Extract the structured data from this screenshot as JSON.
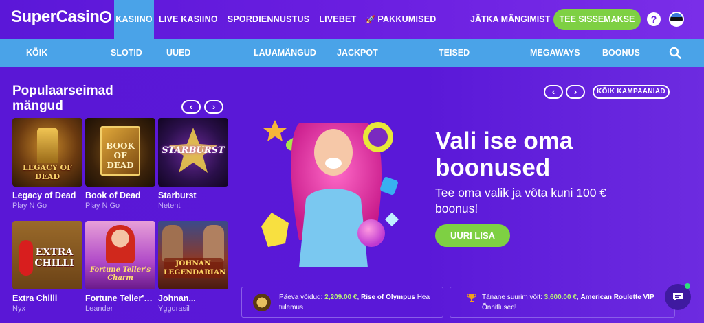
{
  "brand": {
    "logo_text": "SuperCasin"
  },
  "nav": {
    "items": [
      {
        "label": "KASIINO",
        "active": true
      },
      {
        "label": "LIVE KASIINO",
        "active": false
      },
      {
        "label": "SPORDIENNUSTUS",
        "active": false
      },
      {
        "label": "LIVEBET",
        "active": false
      },
      {
        "label": "PAKKUMISED",
        "active": false,
        "icon": "rocket-icon"
      }
    ],
    "continue_label": "JÄTKA MÄNGIMIST",
    "deposit_label": "TEE SISSEMAKSE",
    "help_label": "?"
  },
  "subnav": {
    "items": [
      "KÕIK",
      "SLOTID",
      "UUED",
      "LAUAMÄNGUD",
      "JACKPOT",
      "TEISED",
      "MEGAWAYS",
      "BOONUS"
    ]
  },
  "popular": {
    "title": "Populaarseimad mängud",
    "prev": "‹",
    "next": "›",
    "games": [
      {
        "name": "Legacy of Dead",
        "provider": "Play N Go",
        "art": "LEGACY OF DEAD"
      },
      {
        "name": "Book of Dead",
        "provider": "Play N Go",
        "art": "BOOK OF DEAD"
      },
      {
        "name": "Starburst",
        "provider": "Netent",
        "art": "STARBURST"
      },
      {
        "name": "Extra Chilli",
        "provider": "Nyx",
        "art": "EXTRA CHILLI"
      },
      {
        "name": "Fortune Teller's...",
        "provider": "Leander",
        "art": "Fortune Teller's Charm"
      },
      {
        "name": "Johnan...",
        "provider": "Yggdrasil",
        "art": "JOHNAN LEGENDARIAN"
      }
    ]
  },
  "promo": {
    "prev": "‹",
    "next": "›",
    "all_campaigns_label": "KÕIK KAMPAANIAD",
    "title": "Vali ise oma boonused",
    "subtitle": "Tee oma valik ja võta kuni 100 € boonus!",
    "cta_label": "UURI LISA"
  },
  "tickers": {
    "daily": {
      "prefix": "Päeva võidud:",
      "amount": "2,209.00 €",
      "sep": ",",
      "game": "Rise of Olympus",
      "suffix": "Hea tulemus"
    },
    "top": {
      "prefix": "Tänane suurim võit:",
      "amount": "3,600.00 €",
      "sep": ",",
      "game": "American Roulette VIP",
      "suffix": "Õnnitlused!"
    }
  },
  "colors": {
    "primary": "#5a17d6",
    "accent_blue": "#4aa3e8",
    "cta_green": "#7ed043"
  }
}
